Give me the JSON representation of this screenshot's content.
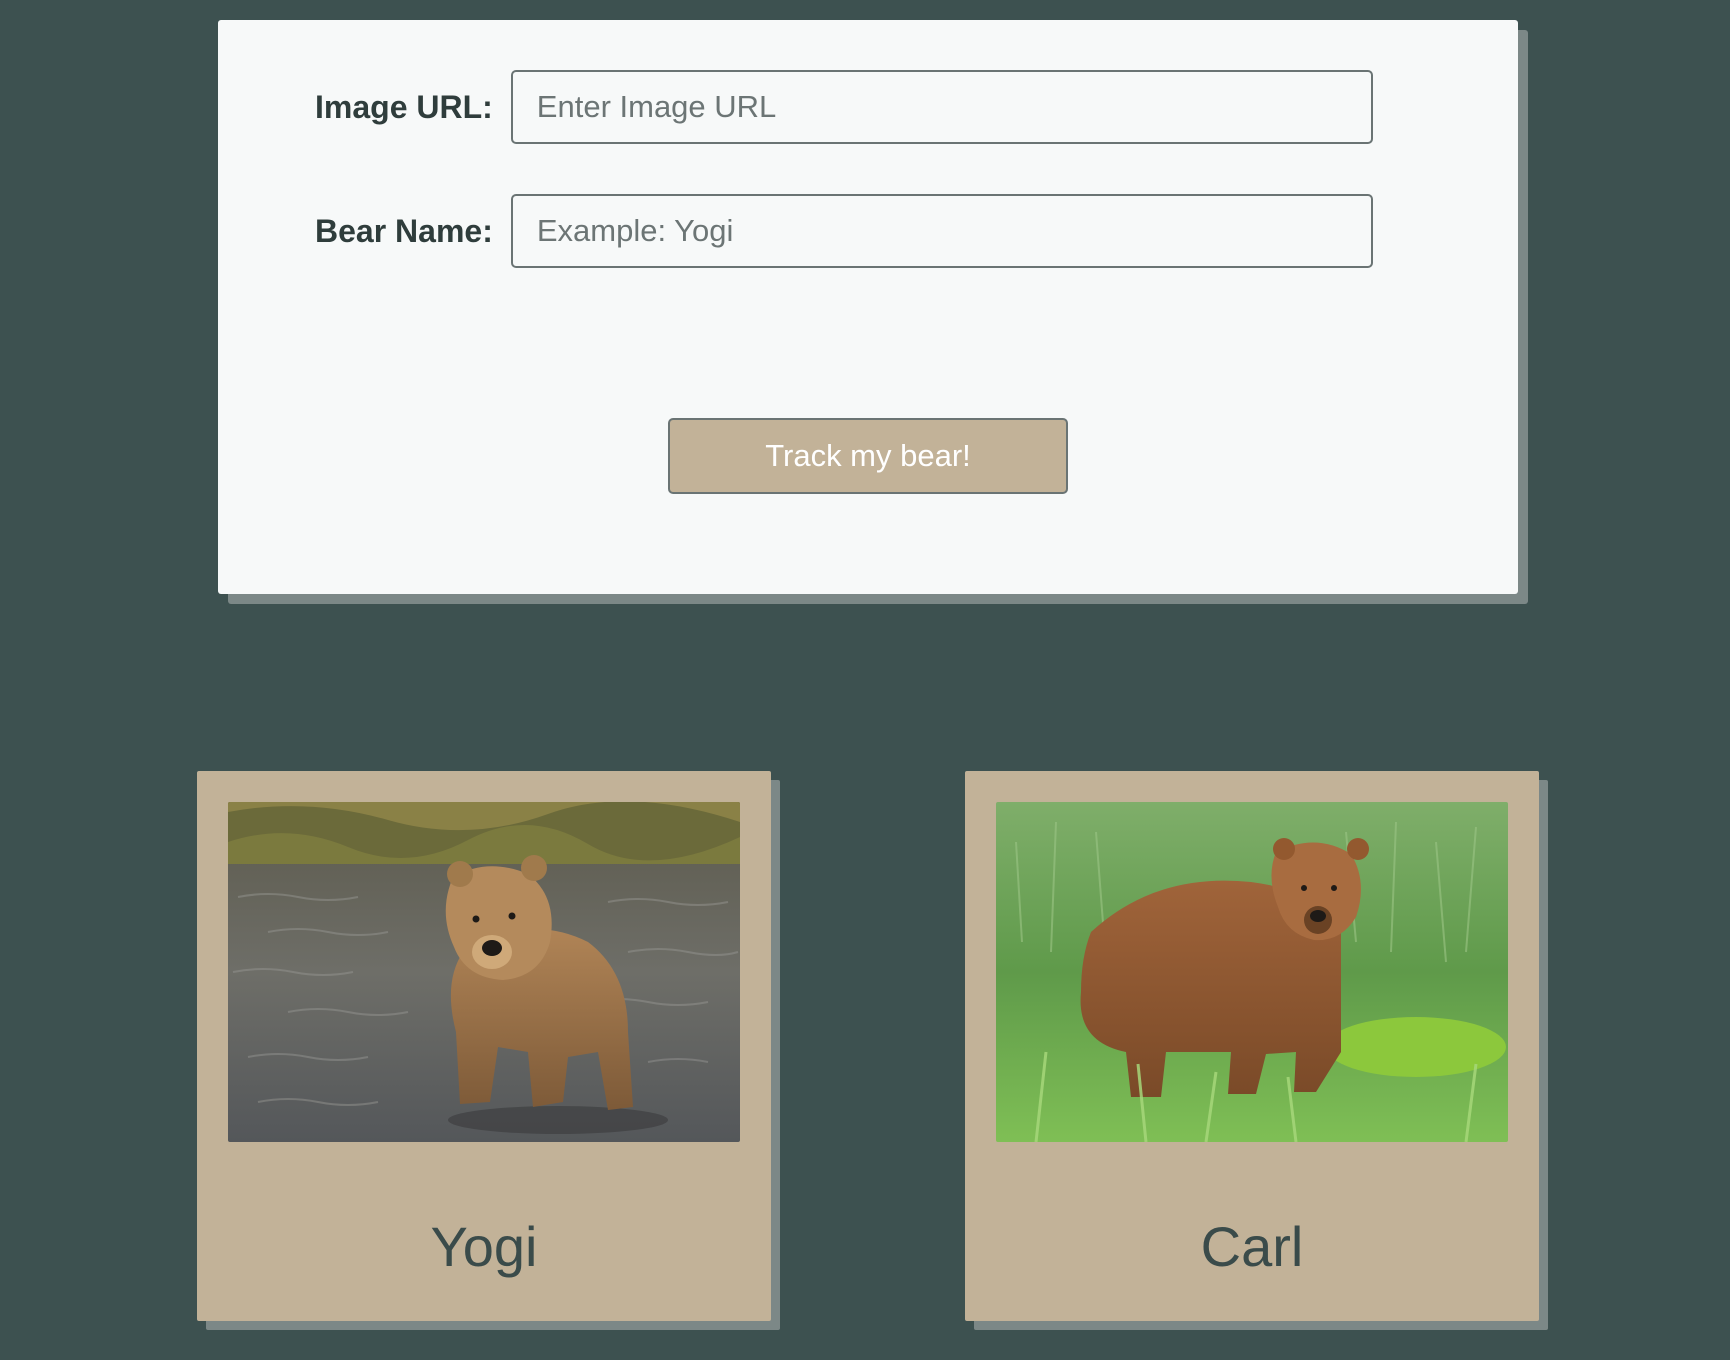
{
  "form": {
    "image_url": {
      "label": "Image URL:",
      "placeholder": "Enter Image URL",
      "value": ""
    },
    "bear_name": {
      "label": "Bear Name:",
      "placeholder": "Example: Yogi",
      "value": ""
    },
    "submit_label": "Track my bear!"
  },
  "bears": [
    {
      "name": "Yogi",
      "photo_icon": "bear-in-river-photo"
    },
    {
      "name": "Carl",
      "photo_icon": "bear-in-grass-photo"
    }
  ],
  "colors": {
    "page_background": "#3d5150",
    "card_background": "#f7f9f9",
    "accent_tan": "#c2b298",
    "text_dark": "#2f3d3c",
    "shadow": "#7c8887"
  }
}
